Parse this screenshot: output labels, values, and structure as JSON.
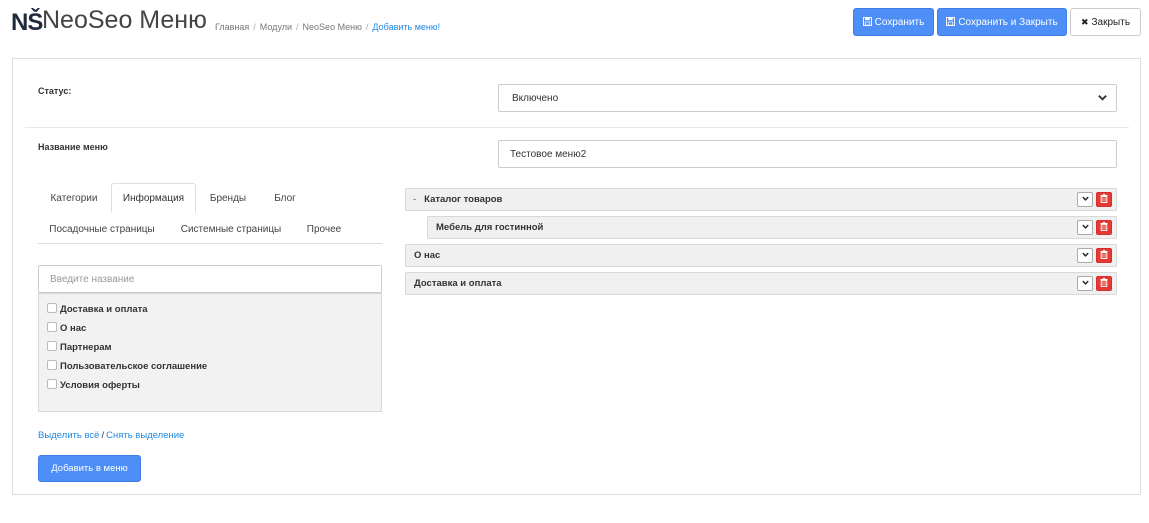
{
  "header": {
    "logo": "NŠ",
    "title": "NeoSeo Меню",
    "breadcrumb": [
      "Главная",
      "Модули",
      "NeoSeo Меню",
      "Добавить меню!"
    ],
    "buttons": {
      "save": "Сохранить",
      "save_close": "Сохранить и Закрыть",
      "close": "Закрыть"
    }
  },
  "form": {
    "status_label": "Статус:",
    "status_value": "Включено",
    "name_label": "Название меню",
    "name_value": "Тестовое меню2"
  },
  "tabs": [
    "Категории",
    "Информация",
    "Бренды",
    "Блог",
    "Посадочные страницы",
    "Системные страницы",
    "Прочее"
  ],
  "active_tab": "Информация",
  "search": {
    "placeholder": "Введите название"
  },
  "items": [
    "Доставка и оплата",
    "О нас",
    "Партнерам",
    "Пользовательское соглашение",
    "Условия оферты"
  ],
  "select_all": "Выделить всё",
  "deselect": "Снять выделение",
  "add_button": "Добавить в меню",
  "menu_tree": [
    {
      "collapse": "-",
      "label": "Каталог товаров"
    },
    {
      "label": "Мебель для гостинной"
    },
    {
      "label": "О нас"
    },
    {
      "label": "Доставка и оплата"
    }
  ],
  "colors": {
    "primary": "#4e8ef7",
    "danger": "#e53935",
    "link": "#1e88e5"
  },
  "icons": {
    "save": "floppy-icon",
    "close": "times-icon",
    "dropdown": "chevron-down-icon",
    "delete": "trash-icon"
  }
}
